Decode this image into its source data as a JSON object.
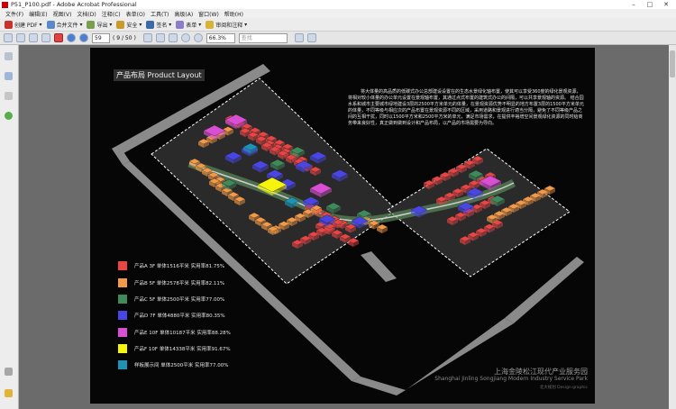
{
  "window": {
    "title": "P51_P100.pdf - Adobe Acrobat Professional"
  },
  "menu": [
    "文件(F)",
    "编辑(E)",
    "视图(V)",
    "文档(D)",
    "注释(C)",
    "表单(O)",
    "工具(T)",
    "高级(A)",
    "窗口(W)",
    "帮助(H)"
  ],
  "toolbar": {
    "create": "创建 PDF",
    "combine": "合并文件",
    "export": "导出",
    "secure": "安全",
    "sign": "签名",
    "forms": "表单",
    "review": "审阅和注释"
  },
  "nav": {
    "page_current": "59",
    "page_total": "( 9 / 50 )",
    "zoom": "66.3%",
    "find_placeholder": "查找"
  },
  "document": {
    "title": "产品布局 Product Layout",
    "paragraph": "将大体量的高品质的低碳式办公总部建设设置在的生态水景绿化轴布置，使其可以享受360度的绿化景观资源，将相对较小体量的办公单元设置在景观轴布置，其通过点式布置的建筑式办公的间隔，可以共享景观轴的资源。 结合园水系和城市主要城市绿地建设3层的2500平方米单元的体量，在景观资源优势不明显的地方布置3层的1500平方米单元的体量，不同等级与相应次的产品布置在景观资源不同的区域，采用道路和景观进行適当分隔，避免了不同等级产品之间的互相干扰，同时以1500平方米和2500平方米的单元，满足市场需求，在提供丰裕增空间景观绿化资源的同时给商务带来良好性，真正做到做到设计和产品布局，以产品的市场需要为导向。",
    "legend": [
      {
        "color": "#e84545",
        "label": "产品A  3F  单体1516平米  实用率81.75%"
      },
      {
        "color": "#f39a48",
        "label": "产品B  5F  单体2578平米  实用率82.11%"
      },
      {
        "color": "#3f8a5a",
        "label": "产品C  5F  单体2500平米  实用率77.00%"
      },
      {
        "color": "#4a46e6",
        "label": "产品D  7F  单体4880平米  实用率80.35%"
      },
      {
        "color": "#d94fd3",
        "label": "产品E  10F  单体10187平米  实用率88.28%"
      },
      {
        "color": "#f4f40c",
        "label": "产品F  10F  单体14338平米  实用率91.67%"
      },
      {
        "color": "#1f93b5",
        "label": "样板展示间  单体2500平米  实用率77.00%"
      }
    ],
    "footer_cn": "上海金陵松江现代产业服务园",
    "footer_en": "Shanghai Jinling Songjiang Modern Industry Service Park",
    "footer_small": "北大规划  Design graphic"
  },
  "colors": {
    "A": "#e84545",
    "B": "#f39a48",
    "C": "#3f8a5a",
    "D": "#4a46e6",
    "E": "#d94fd3",
    "F": "#f4f40c",
    "G": "#1f93b5",
    "road": "#8a8a8a"
  },
  "icons": [
    "pdf-create-icon",
    "combine-icon",
    "export-icon",
    "lock-icon",
    "pen-icon",
    "form-icon",
    "comment-icon",
    "hand-icon",
    "zoom-icon",
    "page-icon"
  ]
}
